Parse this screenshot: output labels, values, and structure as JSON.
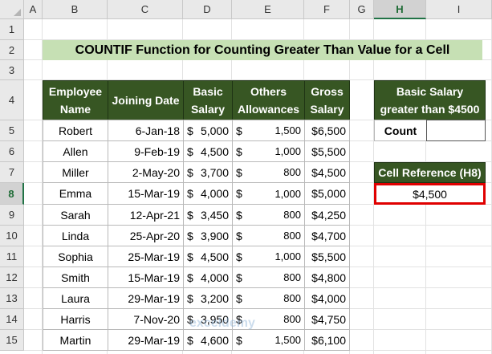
{
  "columns": [
    "A",
    "B",
    "C",
    "D",
    "E",
    "F",
    "G",
    "H",
    "I"
  ],
  "rows": [
    "1",
    "2",
    "3",
    "4",
    "5",
    "6",
    "7",
    "8",
    "9",
    "10",
    "11",
    "12",
    "13",
    "14",
    "15"
  ],
  "title": "COUNTIF Function for Counting Greater Than Value for a Cell",
  "table": {
    "headers": [
      "Employee Name",
      "Joining Date",
      "Basic Salary",
      "Others Allowances",
      "Gross Salary"
    ],
    "rows": [
      {
        "name": "Robert",
        "date": "6-Jan-18",
        "basic": "5,000",
        "other": "1,500",
        "gross": "$6,500"
      },
      {
        "name": "Allen",
        "date": "9-Feb-19",
        "basic": "4,500",
        "other": "1,000",
        "gross": "$5,500"
      },
      {
        "name": "Miller",
        "date": "2-May-20",
        "basic": "3,700",
        "other": "800",
        "gross": "$4,500"
      },
      {
        "name": "Emma",
        "date": "15-Mar-19",
        "basic": "4,000",
        "other": "1,000",
        "gross": "$5,000"
      },
      {
        "name": "Sarah",
        "date": "12-Apr-21",
        "basic": "3,450",
        "other": "800",
        "gross": "$4,250"
      },
      {
        "name": "Linda",
        "date": "25-Apr-20",
        "basic": "3,900",
        "other": "800",
        "gross": "$4,700"
      },
      {
        "name": "Sophia",
        "date": "25-Mar-19",
        "basic": "4,500",
        "other": "1,000",
        "gross": "$5,500"
      },
      {
        "name": "Smith",
        "date": "15-Mar-19",
        "basic": "4,000",
        "other": "800",
        "gross": "$4,800"
      },
      {
        "name": "Laura",
        "date": "29-Mar-19",
        "basic": "3,200",
        "other": "800",
        "gross": "$4,000"
      },
      {
        "name": "Harris",
        "date": "7-Nov-20",
        "basic": "3,950",
        "other": "800",
        "gross": "$4,750"
      },
      {
        "name": "Martin",
        "date": "29-Mar-19",
        "basic": "4,600",
        "other": "1,500",
        "gross": "$6,100"
      }
    ],
    "currency": "$"
  },
  "side": {
    "basic_header_line1": "Basic Salary",
    "basic_header_line2": "greater than $4500",
    "count_label": "Count",
    "count_value": "",
    "ref_header": "Cell Reference (H8)",
    "ref_value": "$4,500"
  },
  "watermark": "exceldemy",
  "colors": {
    "header_green": "#375623",
    "title_green": "#c6e0b4",
    "selection_red": "#e00000"
  }
}
